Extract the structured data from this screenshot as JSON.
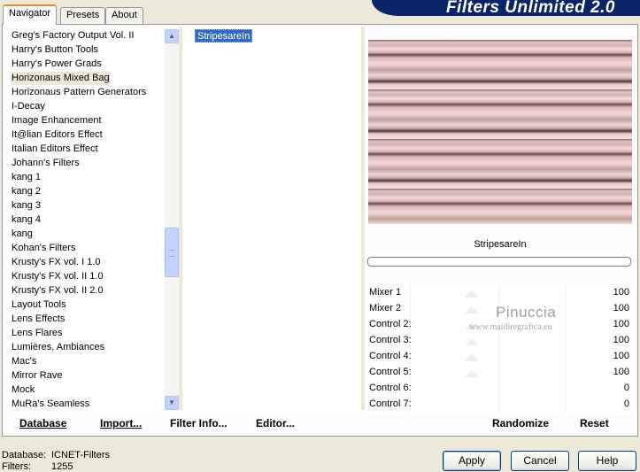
{
  "tabs": [
    {
      "label": "Navigator",
      "active": true
    },
    {
      "label": "Presets",
      "active": false
    },
    {
      "label": "About",
      "active": false
    }
  ],
  "banner": {
    "title": "Filters Unlimited 2.0"
  },
  "categories": [
    "Greg's Factory Output Vol. II",
    "Harry's Button Tools",
    "Harry's Power Grads",
    "Horizonaus Mixed Bag",
    "Horizonaus Pattern Generators",
    "I-Decay",
    "Image Enhancement",
    "It@lian Editors Effect",
    "Italian Editors Effect",
    "Johann's Filters",
    "kang 1",
    "kang 2",
    "kang 3",
    "kang 4",
    "kang",
    "Kohan's Filters",
    "Krusty's FX vol. I 1.0",
    "Krusty's FX vol. II 1.0",
    "Krusty's FX vol. II 2.0",
    "Layout Tools",
    "Lens Effects",
    "Lens Flares",
    "Lumières, Ambiances",
    "Mac's",
    "Mirror Rave",
    "Mock",
    "MuRa's Seamless"
  ],
  "selected_category": "Horizonaus Mixed Bag",
  "filters": [
    "StripesareIn"
  ],
  "selected_filter": "StripesareIn",
  "preview_filter_name": "StripesareIn",
  "controls": [
    {
      "label": "Mixer 1",
      "value": "100",
      "level": 1.0,
      "thumb_visible": true
    },
    {
      "label": "Mixer 2",
      "value": "100",
      "level": 1.0,
      "thumb_visible": true
    },
    {
      "label": "Control 2:",
      "value": "100",
      "level": 1.0,
      "thumb_visible": true
    },
    {
      "label": "Control 3:",
      "value": "100",
      "level": 1.0,
      "thumb_visible": true
    },
    {
      "label": "Control 4:",
      "value": "100",
      "level": 1.0,
      "thumb_visible": true
    },
    {
      "label": "Control 5:",
      "value": "100",
      "level": 1.0,
      "thumb_visible": true
    },
    {
      "label": "Control 6:",
      "value": "0",
      "level": 0.0,
      "thumb_visible": false
    },
    {
      "label": "Control 7:",
      "value": "0",
      "level": 0.0,
      "thumb_visible": false
    }
  ],
  "watermark": {
    "name": "Pinuccia",
    "url": "www.maidiregrafica.eu"
  },
  "left_bar": {
    "database": "Database",
    "import": "Import...",
    "filter_info": "Filter Info...",
    "editor": "Editor..."
  },
  "right_bar": {
    "randomize": "Randomize",
    "reset": "Reset"
  },
  "status": {
    "database_label": "Database:",
    "database_value": "ICNET-Filters",
    "filters_label": "Filters:",
    "filters_value": "1255"
  },
  "buttons": {
    "apply": "Apply",
    "cancel": "Cancel",
    "help": "Help"
  },
  "colors": {
    "selection": "#316ac5",
    "banner": "#0a246a",
    "tab_accent": "#e68b2c"
  }
}
